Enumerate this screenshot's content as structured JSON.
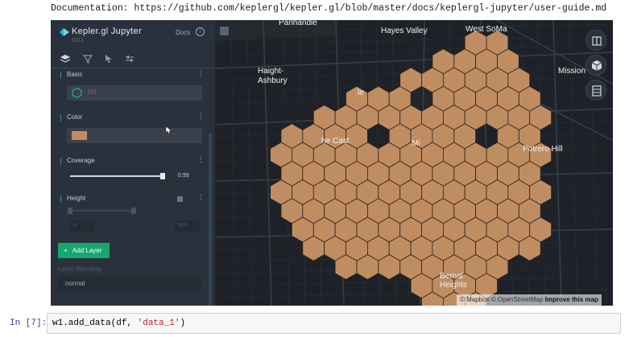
{
  "notebook": {
    "doc_label": "Documentation:",
    "doc_url": "https://github.com/keplergl/kepler.gl/blob/master/docs/keplergl-jupyter/user-guide.md",
    "next_cell": {
      "prompt": "In [7]:",
      "code_prefix": "w1.add_data(df, ",
      "code_string": "'data_1'",
      "code_suffix": ")"
    }
  },
  "sidebar": {
    "app_title": "Kepler.gl Jupyter",
    "version": "0.0.1",
    "docs_label": "Docs",
    "info_icon": "i",
    "tabs": [
      {
        "icon": "layers-icon",
        "active": true
      },
      {
        "icon": "filter-icon",
        "active": false
      },
      {
        "icon": "interaction-icon",
        "active": false
      },
      {
        "icon": "settings-icon",
        "active": false
      }
    ],
    "basic": {
      "label": "Basic",
      "layer_type": "H3"
    },
    "color": {
      "label": "Color",
      "swatch": "#c08d63"
    },
    "coverage": {
      "label": "Coverage",
      "value": "0.99",
      "fraction": 0.99
    },
    "height": {
      "label": "Height",
      "min_value": "0",
      "max_value": "500"
    },
    "add_layer_label": "Add Layer",
    "add_layer_plus": "+",
    "blending_label": "Layer Blending",
    "blending_value": "normal"
  },
  "map": {
    "fill_color": "#c08d63",
    "labels": {
      "panhandle": "Panhandle",
      "hayes_valley": "Hayes Valley",
      "west_soma": "West SoMa",
      "haight_1": "Haight-",
      "haight_2": "Ashbury",
      "mission": "Mission",
      "castro_partial_top": "le",
      "castro": "he Cast",
      "mission_partial": "Mi",
      "potrero_hill": "Potrero Hill",
      "bernal_1": "Bernal",
      "bernal_2": "Heights"
    },
    "buttons": [
      "split-map-icon",
      "3d-map-icon",
      "legend-icon"
    ],
    "attribution": {
      "mapbox": "© Mapbox",
      "osm": "© OpenStreetMap",
      "improve": "Improve this map"
    }
  }
}
